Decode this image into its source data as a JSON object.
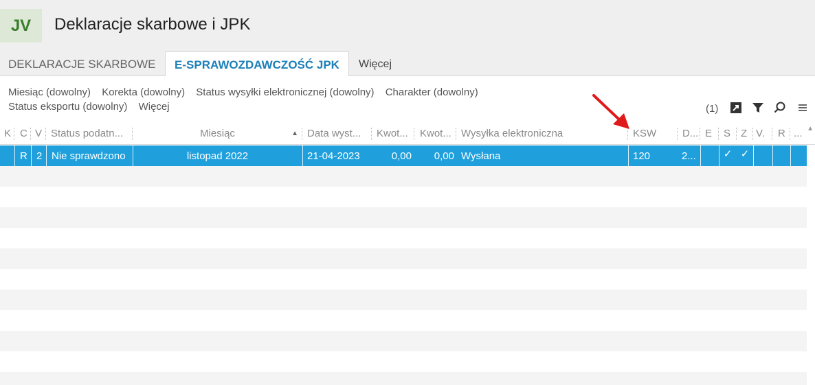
{
  "app": {
    "logo": "JV",
    "title": "Deklaracje skarbowe i JPK"
  },
  "tabs": [
    {
      "label": "DEKLARACJE SKARBOWE"
    },
    {
      "label": "E-SPRAWOZDAWCZOŚĆ JPK"
    },
    {
      "label": "Więcej"
    }
  ],
  "filters": {
    "row1": [
      "Miesiąc (dowolny)",
      "Korekta (dowolny)",
      "Status wysyłki elektronicznej (dowolny)",
      "Charakter (dowolny)"
    ],
    "row2": [
      "Status eksportu (dowolny)",
      "Więcej"
    ]
  },
  "toolbar": {
    "count": "(1)"
  },
  "columns": [
    "K",
    "C",
    "V",
    "Status podatn...",
    "Miesiąc",
    "Data wyst...",
    "Kwot...",
    "Kwot...",
    "Wysyłka elektroniczna",
    "KSW",
    "D...",
    "E",
    "S",
    "Z",
    "V.",
    "R",
    "..."
  ],
  "rows": [
    {
      "K": "",
      "C": "R",
      "V": "2",
      "status": "Nie sprawdzono",
      "miesiac": "listopad 2022",
      "data": "21-04-2023",
      "kwota1": "0,00",
      "kwota2": "0,00",
      "wysylka": "Wysłana",
      "ksw": "120",
      "d": "2...",
      "e": "",
      "s": "✓",
      "z": "✓",
      "v": "",
      "r": ""
    }
  ],
  "colors": {
    "selection": "#1fa0dc",
    "tab_active": "#1b7fb8",
    "logo": "#3b7d2c",
    "arrow": "#e0191b"
  }
}
